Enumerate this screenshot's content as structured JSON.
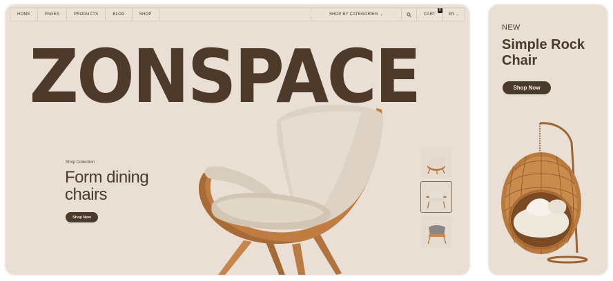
{
  "nav": {
    "items": [
      {
        "label": "HOME",
        "name": "nav-home"
      },
      {
        "label": "PAGES",
        "name": "nav-pages"
      },
      {
        "label": "PRODUCTS",
        "name": "nav-products"
      },
      {
        "label": "BLOG",
        "name": "nav-blog"
      },
      {
        "label": "SHOP",
        "name": "nav-shop"
      }
    ],
    "categories_label": "SHOP BY CATEGORIES",
    "cart_label": "CART",
    "cart_count": "0",
    "language": "EN"
  },
  "hero": {
    "brand": "ZONSPACE",
    "eyebrow": "Shop Collection",
    "title": "Form dining chairs",
    "button_label": "Shop Now"
  },
  "side": {
    "badge": "NEW",
    "title": "Simple Rock Chair",
    "button_label": "Shop Now"
  },
  "colors": {
    "background": "#e9dfd4",
    "text": "#4a3a2c",
    "button": "#4a3a2c",
    "button_text": "#f4ede6"
  }
}
